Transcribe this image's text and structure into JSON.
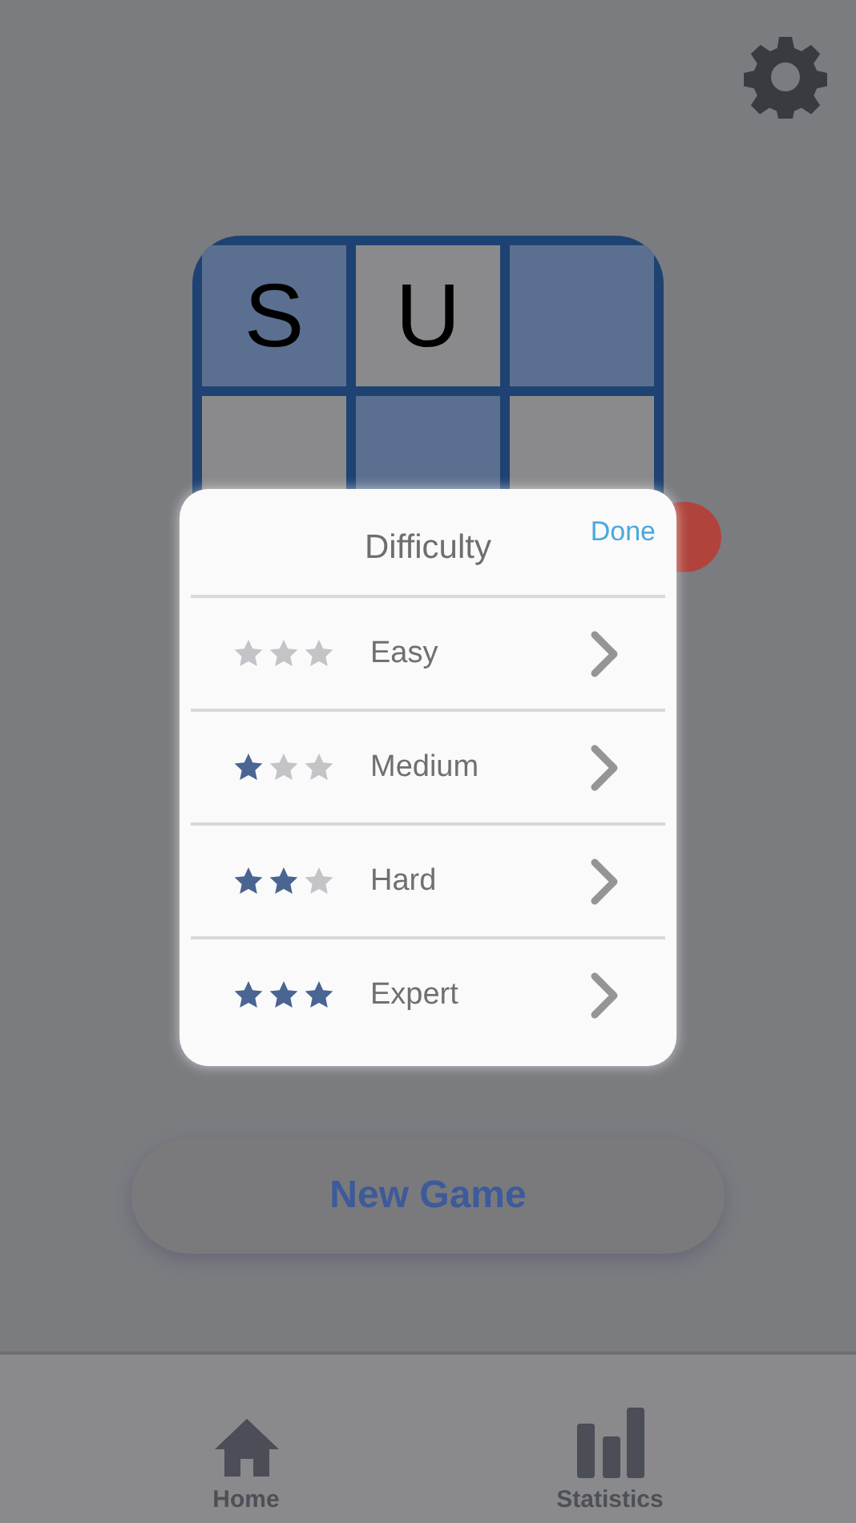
{
  "logo": {
    "tiles": [
      {
        "letter": "S",
        "shaded": true
      },
      {
        "letter": "U",
        "shaded": false
      },
      {
        "shaded": true
      },
      {
        "shaded": false
      },
      {
        "shaded": true
      },
      {
        "shaded": false
      }
    ]
  },
  "dialog": {
    "title": "Difficulty",
    "done": "Done",
    "levels": [
      {
        "label": "Easy",
        "stars": 0
      },
      {
        "label": "Medium",
        "stars": 1
      },
      {
        "label": "Hard",
        "stars": 2
      },
      {
        "label": "Expert",
        "stars": 3
      }
    ]
  },
  "new_game_button": "New Game",
  "tab_bar": [
    {
      "label": "Home"
    },
    {
      "label": "Statistics"
    }
  ]
}
